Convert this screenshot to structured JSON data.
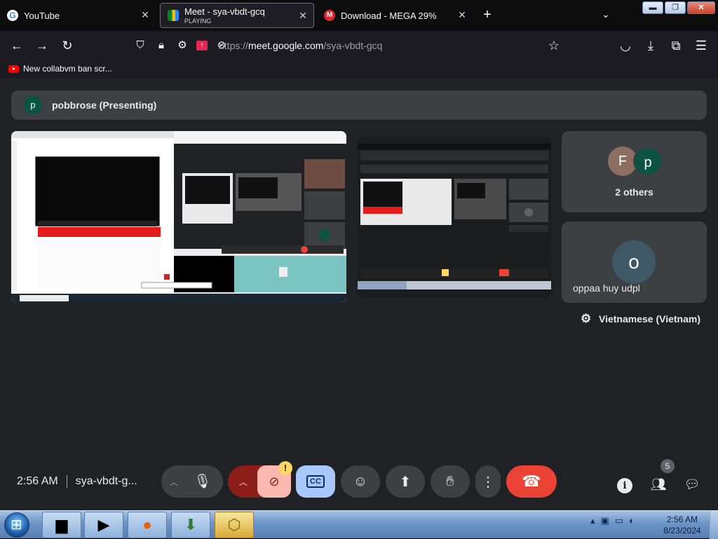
{
  "browser": {
    "tabs": [
      {
        "title": "YouTube",
        "subtitle": ""
      },
      {
        "title": "Meet - sya-vbdt-gcq",
        "subtitle": "PLAYING"
      },
      {
        "title": "Download - MEGA 29%",
        "subtitle": ""
      }
    ],
    "url_prefix": "https://",
    "url_host": "meet.google.com",
    "url_path": "/sya-vbdt-gcq",
    "bookmark": "New collabvm ban scr..."
  },
  "meet": {
    "presenting_avatar": "p",
    "presenting_label": "pobbrose (Presenting)",
    "others_avatars": [
      "F",
      "p"
    ],
    "others_label": "2 others",
    "oppaa_avatar": "o",
    "oppaa_name": "oppaa huy udpl",
    "caption_language": "Vietnamese (Vietnam)",
    "time": "2:56 AM",
    "meeting_code": "sya-vbdt-g...",
    "people_count": "5",
    "warning_badge": "!",
    "cc_label": "CC"
  },
  "taskbar": {
    "clock_time": "2:56 AM",
    "clock_date": "8/23/2024"
  },
  "icons": {
    "colors": {
      "accent": "#a8c7fa",
      "hangup": "#ea4335",
      "meet_bg": "#202124",
      "tile_bg": "#3c4043"
    }
  }
}
